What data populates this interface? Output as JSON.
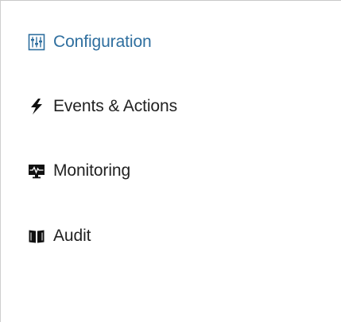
{
  "nav": {
    "items": [
      {
        "label": "Configuration",
        "icon": "sliders-icon",
        "active": true
      },
      {
        "label": "Events & Actions",
        "icon": "lightning-bolt-icon",
        "active": false
      },
      {
        "label": "Monitoring",
        "icon": "monitor-pulse-icon",
        "active": false
      },
      {
        "label": "Audit",
        "icon": "open-book-icon",
        "active": false
      }
    ]
  },
  "colors": {
    "active_text": "#2f6f9f",
    "text": "#222222",
    "border": "#c8c8c8"
  }
}
